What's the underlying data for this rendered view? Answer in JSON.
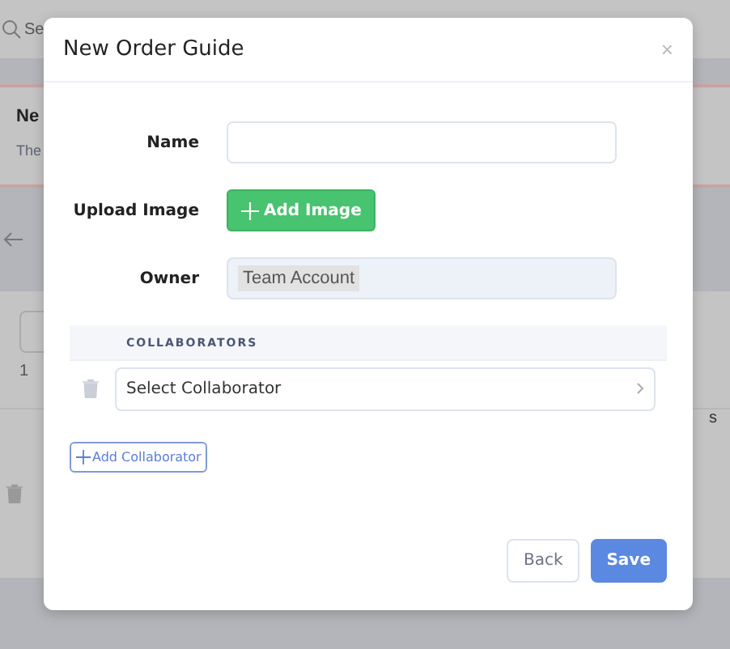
{
  "background": {
    "search_text": "Se",
    "notice_title": "Ne",
    "notice_text": "The",
    "count_text": "1",
    "row_text": "s"
  },
  "modal": {
    "title": "New Order Guide",
    "close": "×",
    "fields": [
      {
        "kind": "input",
        "label": "Name"
      },
      {
        "kind": "upload",
        "label": "Upload Image",
        "button": "Add Image"
      },
      {
        "kind": "readonly",
        "label": "Owner",
        "value": "Team Account"
      }
    ],
    "collaborators_header": "COLLABORATORS",
    "collaborators": [
      {
        "placeholder": "Select Collaborator"
      }
    ],
    "add_collaborator": "Add Collaborator",
    "buttons": [
      {
        "kind": "secondary",
        "label": "Back"
      },
      {
        "kind": "primary",
        "label": "Save"
      }
    ]
  }
}
